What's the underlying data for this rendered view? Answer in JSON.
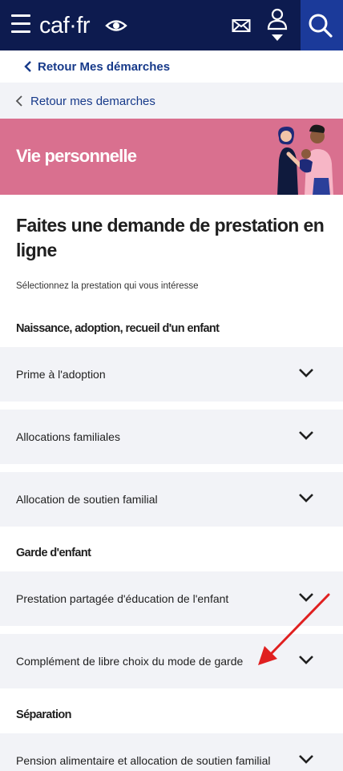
{
  "header": {
    "logo_text": "caf·fr",
    "icons": [
      "menu-icon",
      "eye-icon",
      "mail-icon",
      "user-icon",
      "search-icon"
    ],
    "background_color": "#0d1b4f",
    "search_button_color": "#1b3a9a"
  },
  "back_links": {
    "primary": "Retour Mes démarches",
    "secondary": "Retour mes demarches"
  },
  "banner": {
    "title": "Vie personnelle",
    "color": "#d9708f"
  },
  "main": {
    "title": "Faites une demande de prestation en ligne",
    "intro": "Sélectionnez la prestation qui vous intéresse",
    "sections": [
      {
        "title": "Naissance, adoption, recueil d'un enfant",
        "items": [
          "Prime à l'adoption",
          "Allocations familiales",
          "Allocation de soutien familial"
        ]
      },
      {
        "title": "Garde d'enfant",
        "items": [
          "Prestation partagée d'éducation de l'enfant",
          "Complément de libre choix du mode de garde"
        ]
      },
      {
        "title": "Séparation",
        "items": [
          "Pension alimentaire et allocation de soutien familial"
        ]
      }
    ]
  },
  "annotation": {
    "arrow_color": "#e02020"
  }
}
